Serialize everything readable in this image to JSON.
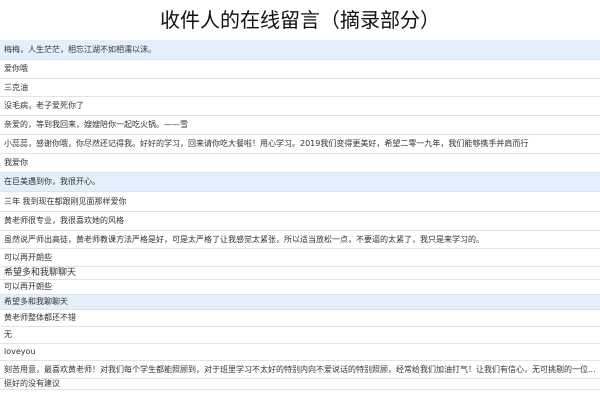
{
  "page": {
    "title": "收件人的在线留言（摘录部分）"
  },
  "messages": [
    {
      "text": "梅梅，人生茫茫，相忘江湖不如相濡以沫。",
      "hl": true,
      "h": 20
    },
    {
      "text": "爱你哦",
      "hl": false,
      "h": 19
    },
    {
      "text": "三克油",
      "hl": false,
      "h": 18
    },
    {
      "text": "没毛病，老子爱死你了",
      "hl": false,
      "h": 19
    },
    {
      "text": "亲爱的，等到我回来，嫂嫂陪你一起吃火锅。——雪",
      "hl": false,
      "h": 19
    },
    {
      "text": "小蕊蕊，感谢你哦，你尽然还记得我。好好的学习，回来请你吃大餐啦！用心学习。2019我们变得更美好，希望二零一九年，我们能够携手并肩而行",
      "hl": false,
      "h": 19
    },
    {
      "text": "我爱你",
      "hl": false,
      "h": 19
    },
    {
      "text": "在巨美遇到你，我很开心。",
      "hl": true,
      "h": 19
    },
    {
      "text": "三年 我到现在都跟刚见面那样爱你",
      "hl": false,
      "h": 20
    },
    {
      "text": "黄老师很专业，我很喜欢她的风格",
      "hl": false,
      "h": 19
    },
    {
      "text": "虽然说严师出高徒，黄老师教课方法严格是好，可是太严格了让我感觉太紧张，所以适当放松一点，不要逼的太紧了，我只是来学习的。",
      "hl": false,
      "h": 18
    },
    {
      "text": "可以再开朗些",
      "hl": false,
      "h": 18
    },
    {
      "text": "希望多和我聊聊天",
      "hl": false,
      "h": 13,
      "tall": true
    },
    {
      "text": "可以再开朗些",
      "hl": false,
      "h": 15
    },
    {
      "text": "希望多和我聊聊天",
      "hl": true,
      "h": 15
    },
    {
      "text": "黄老师整体都还不错",
      "hl": false,
      "h": 17
    },
    {
      "text": "无",
      "hl": false,
      "h": 17
    },
    {
      "text": "loveyou",
      "hl": false,
      "h": 17
    },
    {
      "text": "刻苦用意，最喜欢黄老师！对我们每个学生都能照顾到，对于班里学习不太好的特别内向不爱说话的特别照顾，经常给我们加油打气！让我们有信心，无可挑剔的一位...",
      "hl": false,
      "h": 18
    },
    {
      "text": "挺好的没有建议",
      "hl": false,
      "h": 11
    }
  ]
}
